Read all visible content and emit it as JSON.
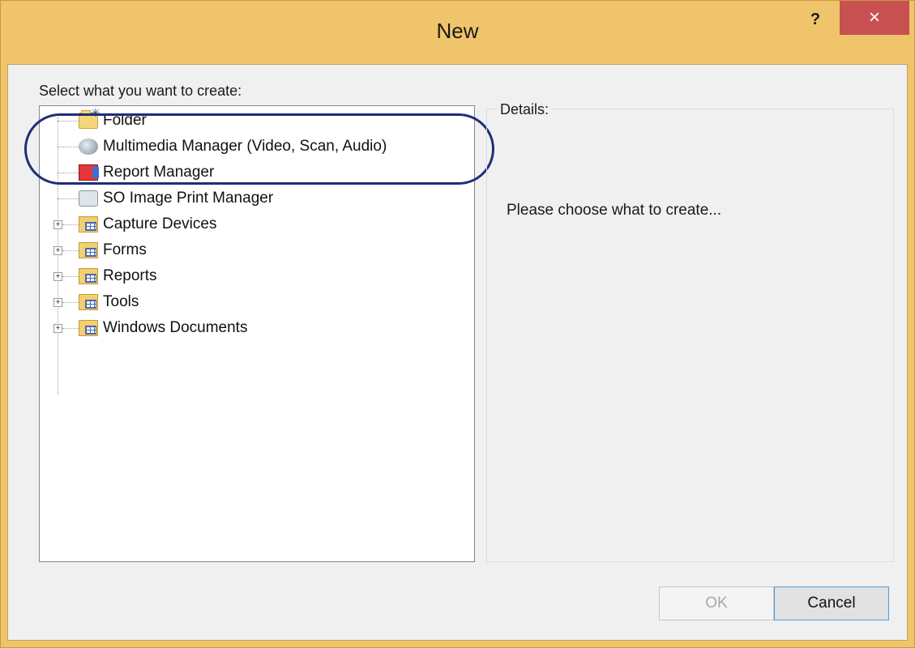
{
  "window": {
    "title": "New",
    "help_glyph": "?",
    "close_glyph": "×"
  },
  "prompt": "Select what you want to create:",
  "tree": {
    "items": [
      {
        "label": "Folder",
        "icon": "new-folder-icon",
        "expandable": false
      },
      {
        "label": "Multimedia Manager (Video, Scan, Audio)",
        "icon": "multimedia-icon",
        "expandable": false
      },
      {
        "label": "Report Manager",
        "icon": "report-manager-icon",
        "expandable": false
      },
      {
        "label": "SO Image Print Manager",
        "icon": "printer-icon",
        "expandable": false
      },
      {
        "label": "Capture Devices",
        "icon": "folder-group-icon",
        "expandable": true
      },
      {
        "label": "Forms",
        "icon": "folder-group-icon",
        "expandable": true
      },
      {
        "label": "Reports",
        "icon": "folder-group-icon",
        "expandable": true
      },
      {
        "label": "Tools",
        "icon": "folder-group-icon",
        "expandable": true
      },
      {
        "label": "Windows Documents",
        "icon": "folder-group-icon",
        "expandable": true
      }
    ],
    "expander_glyph": "+"
  },
  "details": {
    "legend": "Details:",
    "message": "Please choose what to create..."
  },
  "buttons": {
    "ok": "OK",
    "cancel": "Cancel"
  },
  "colors": {
    "titlebar": "#f0c46a",
    "close": "#c75050",
    "highlight": "#1f2d7a"
  }
}
